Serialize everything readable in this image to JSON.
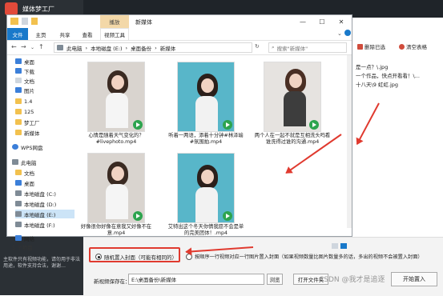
{
  "app": {
    "title": "媒体梦工厂",
    "left_note": "主软件只有视频功能，请勿用于非法用途，软件支持合法，谢谢…",
    "right_panel": {
      "delete_selected": "删除已选",
      "clear_table": "清空表格",
      "lines": [
        "是一点？\\.jpg",
        "一个作品，快点开看看！\\...",
        "十八天\\9 虹虹.jpg"
      ]
    },
    "options": {
      "random_cover": "随机置入封面（可能有相同的）",
      "sequential_cover": "按顺序一行视频对应一行图片置入封面（如果视频数量比图片数量多的话，多出的视频不会被置入封面）"
    },
    "save_path_label": "新视频保存在：",
    "save_path_value": "E:\\桌面备份\\新媒体",
    "browse_button": "浏览",
    "open_folder_button": "打开文件夹",
    "start_button": "开始置入",
    "watermark": "CSDN @我才是追逐"
  },
  "explorer": {
    "context_tab": "播放",
    "window_title": "新媒体",
    "ribbon_tabs": [
      "文件",
      "主页",
      "共享",
      "查看",
      "视频工具"
    ],
    "breadcrumb": [
      "此电脑",
      "本地磁盘 (E:)",
      "桌面备份",
      "新媒体"
    ],
    "search_placeholder": "搜索\"新媒体\"",
    "nav_items": [
      "桌面",
      "下载",
      "文档",
      "图片",
      "1.4",
      "125",
      "梦工厂",
      "新媒体",
      "WPS网盘",
      "此电脑",
      "文档",
      "桌面",
      "本地磁盘 (C:)",
      "本地磁盘 (D:)",
      "本地磁盘 (E:)",
      "本地磁盘 (F:)",
      "网络"
    ],
    "status": "5 个项目",
    "files": [
      "心情是随着天气变化的？#livephoto.mp4",
      "听着一两语，添着十分钟#林泽瑜#氛围拍.mp4",
      "两个人在一起不就是互相洗头吗看谁洗得过谁的沟通.mp4",
      "好像很你好像在意我又好像不在意.mp4",
      "艾特出这个冬天你情我愿不会是单的完美团体！.mp4"
    ]
  }
}
